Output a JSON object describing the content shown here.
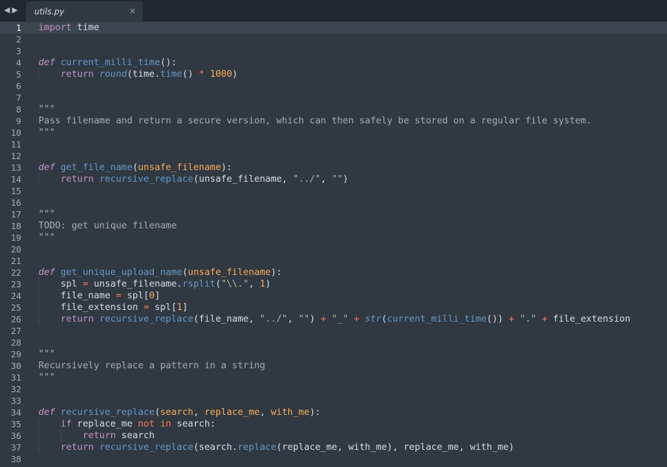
{
  "tab": {
    "title": "utils.py",
    "close_glyph": "×"
  },
  "nav": {
    "back_glyph": "◀",
    "forward_glyph": "▶"
  },
  "editor": {
    "current_line": 1,
    "lines": [
      {
        "n": "1",
        "tokens": [
          {
            "t": "import",
            "c": "k"
          },
          {
            "t": " time",
            "c": "t"
          }
        ]
      },
      {
        "n": "2",
        "tokens": []
      },
      {
        "n": "3",
        "tokens": []
      },
      {
        "n": "4",
        "tokens": [
          {
            "t": "def",
            "c": "d"
          },
          {
            "t": " ",
            "c": "t"
          },
          {
            "t": "current_milli_time",
            "c": "f"
          },
          {
            "t": "():",
            "c": "t"
          }
        ]
      },
      {
        "n": "5",
        "guides": [
          0
        ],
        "tokens": [
          {
            "t": "    ",
            "c": "t"
          },
          {
            "t": "return",
            "c": "k"
          },
          {
            "t": " ",
            "c": "t"
          },
          {
            "t": "round",
            "c": "b"
          },
          {
            "t": "(time.",
            "c": "t"
          },
          {
            "t": "time",
            "c": "f"
          },
          {
            "t": "() ",
            "c": "t"
          },
          {
            "t": "*",
            "c": "o"
          },
          {
            "t": " ",
            "c": "t"
          },
          {
            "t": "1000",
            "c": "n"
          },
          {
            "t": ")",
            "c": "t"
          }
        ]
      },
      {
        "n": "6",
        "tokens": []
      },
      {
        "n": "7",
        "tokens": []
      },
      {
        "n": "8",
        "tokens": [
          {
            "t": "\"\"\"",
            "c": "c"
          }
        ]
      },
      {
        "n": "9",
        "tokens": [
          {
            "t": "Pass filename and return a secure version, which can then safely be stored on a regular file system.",
            "c": "c"
          }
        ]
      },
      {
        "n": "10",
        "tokens": [
          {
            "t": "\"\"\"",
            "c": "c"
          }
        ]
      },
      {
        "n": "11",
        "tokens": []
      },
      {
        "n": "12",
        "tokens": []
      },
      {
        "n": "13",
        "tokens": [
          {
            "t": "def",
            "c": "d"
          },
          {
            "t": " ",
            "c": "t"
          },
          {
            "t": "get_file_name",
            "c": "f"
          },
          {
            "t": "(",
            "c": "t"
          },
          {
            "t": "unsafe_filename",
            "c": "p"
          },
          {
            "t": "):",
            "c": "t"
          }
        ]
      },
      {
        "n": "14",
        "guides": [
          0
        ],
        "tokens": [
          {
            "t": "    ",
            "c": "t"
          },
          {
            "t": "return",
            "c": "k"
          },
          {
            "t": " ",
            "c": "t"
          },
          {
            "t": "recursive_replace",
            "c": "f"
          },
          {
            "t": "(unsafe_filename, ",
            "c": "t"
          },
          {
            "t": "\"../\"",
            "c": "s"
          },
          {
            "t": ", ",
            "c": "t"
          },
          {
            "t": "\"\"",
            "c": "s"
          },
          {
            "t": ")",
            "c": "t"
          }
        ]
      },
      {
        "n": "15",
        "tokens": []
      },
      {
        "n": "16",
        "tokens": []
      },
      {
        "n": "17",
        "tokens": [
          {
            "t": "\"\"\"",
            "c": "c"
          }
        ]
      },
      {
        "n": "18",
        "tokens": [
          {
            "t": "TODO: get unique filename",
            "c": "c"
          }
        ]
      },
      {
        "n": "19",
        "tokens": [
          {
            "t": "\"\"\"",
            "c": "c"
          }
        ]
      },
      {
        "n": "20",
        "tokens": []
      },
      {
        "n": "21",
        "tokens": []
      },
      {
        "n": "22",
        "tokens": [
          {
            "t": "def",
            "c": "d"
          },
          {
            "t": " ",
            "c": "t"
          },
          {
            "t": "get_unique_upload_name",
            "c": "f"
          },
          {
            "t": "(",
            "c": "t"
          },
          {
            "t": "unsafe_filename",
            "c": "p"
          },
          {
            "t": "):",
            "c": "t"
          }
        ]
      },
      {
        "n": "23",
        "guides": [
          0
        ],
        "tokens": [
          {
            "t": "    spl ",
            "c": "t"
          },
          {
            "t": "=",
            "c": "o"
          },
          {
            "t": " unsafe_filename.",
            "c": "t"
          },
          {
            "t": "rsplit",
            "c": "f"
          },
          {
            "t": "(",
            "c": "t"
          },
          {
            "t": "\"\\\\.\"",
            "c": "s"
          },
          {
            "t": ", ",
            "c": "t"
          },
          {
            "t": "1",
            "c": "n"
          },
          {
            "t": ")",
            "c": "t"
          }
        ]
      },
      {
        "n": "24",
        "guides": [
          0
        ],
        "tokens": [
          {
            "t": "    file_name ",
            "c": "t"
          },
          {
            "t": "=",
            "c": "o"
          },
          {
            "t": " spl[",
            "c": "t"
          },
          {
            "t": "0",
            "c": "n"
          },
          {
            "t": "]",
            "c": "t"
          }
        ]
      },
      {
        "n": "25",
        "guides": [
          0
        ],
        "tokens": [
          {
            "t": "    file_extension ",
            "c": "t"
          },
          {
            "t": "=",
            "c": "o"
          },
          {
            "t": " spl[",
            "c": "t"
          },
          {
            "t": "1",
            "c": "n"
          },
          {
            "t": "]",
            "c": "t"
          }
        ]
      },
      {
        "n": "26",
        "guides": [
          0
        ],
        "tokens": [
          {
            "t": "    ",
            "c": "t"
          },
          {
            "t": "return",
            "c": "k"
          },
          {
            "t": " ",
            "c": "t"
          },
          {
            "t": "recursive_replace",
            "c": "f"
          },
          {
            "t": "(file_name, ",
            "c": "t"
          },
          {
            "t": "\"../\"",
            "c": "s"
          },
          {
            "t": ", ",
            "c": "t"
          },
          {
            "t": "\"\"",
            "c": "s"
          },
          {
            "t": ") ",
            "c": "t"
          },
          {
            "t": "+",
            "c": "o"
          },
          {
            "t": " ",
            "c": "t"
          },
          {
            "t": "\"_\"",
            "c": "s"
          },
          {
            "t": " ",
            "c": "t"
          },
          {
            "t": "+",
            "c": "o"
          },
          {
            "t": " ",
            "c": "t"
          },
          {
            "t": "str",
            "c": "b"
          },
          {
            "t": "(",
            "c": "t"
          },
          {
            "t": "current_milli_time",
            "c": "f"
          },
          {
            "t": "()) ",
            "c": "t"
          },
          {
            "t": "+",
            "c": "o"
          },
          {
            "t": " ",
            "c": "t"
          },
          {
            "t": "\".\"",
            "c": "s"
          },
          {
            "t": " ",
            "c": "t"
          },
          {
            "t": "+",
            "c": "o"
          },
          {
            "t": " file_extension",
            "c": "t"
          }
        ]
      },
      {
        "n": "27",
        "tokens": []
      },
      {
        "n": "28",
        "tokens": []
      },
      {
        "n": "29",
        "tokens": [
          {
            "t": "\"\"\"",
            "c": "c"
          }
        ]
      },
      {
        "n": "30",
        "tokens": [
          {
            "t": "Recursively replace a pattern in a string",
            "c": "c"
          }
        ]
      },
      {
        "n": "31",
        "tokens": [
          {
            "t": "\"\"\"",
            "c": "c"
          }
        ]
      },
      {
        "n": "32",
        "tokens": []
      },
      {
        "n": "33",
        "tokens": []
      },
      {
        "n": "34",
        "tokens": [
          {
            "t": "def",
            "c": "d"
          },
          {
            "t": " ",
            "c": "t"
          },
          {
            "t": "recursive_replace",
            "c": "f"
          },
          {
            "t": "(",
            "c": "t"
          },
          {
            "t": "search",
            "c": "p"
          },
          {
            "t": ", ",
            "c": "t"
          },
          {
            "t": "replace_me",
            "c": "p"
          },
          {
            "t": ", ",
            "c": "t"
          },
          {
            "t": "with_me",
            "c": "p"
          },
          {
            "t": "):",
            "c": "t"
          }
        ]
      },
      {
        "n": "35",
        "guides": [
          0
        ],
        "tokens": [
          {
            "t": "    ",
            "c": "t"
          },
          {
            "t": "if",
            "c": "k"
          },
          {
            "t": " replace_me ",
            "c": "t"
          },
          {
            "t": "not in",
            "c": "o"
          },
          {
            "t": " search:",
            "c": "t"
          }
        ]
      },
      {
        "n": "36",
        "guides": [
          0,
          1
        ],
        "tokens": [
          {
            "t": "        ",
            "c": "t"
          },
          {
            "t": "return",
            "c": "k"
          },
          {
            "t": " search",
            "c": "t"
          }
        ]
      },
      {
        "n": "37",
        "guides": [
          0
        ],
        "tokens": [
          {
            "t": "    ",
            "c": "t"
          },
          {
            "t": "return",
            "c": "k"
          },
          {
            "t": " ",
            "c": "t"
          },
          {
            "t": "recursive_replace",
            "c": "f"
          },
          {
            "t": "(search.",
            "c": "t"
          },
          {
            "t": "replace",
            "c": "f"
          },
          {
            "t": "(replace_me, with_me), replace_me, with_me)",
            "c": "t"
          }
        ]
      },
      {
        "n": "38",
        "tokens": []
      }
    ]
  },
  "colors": {
    "background": "#303841",
    "keyword": "#c695c6",
    "function": "#6699cc",
    "string": "#99c794",
    "number": "#f9ae58",
    "operator": "#f97b58",
    "comment": "#a7adba"
  }
}
